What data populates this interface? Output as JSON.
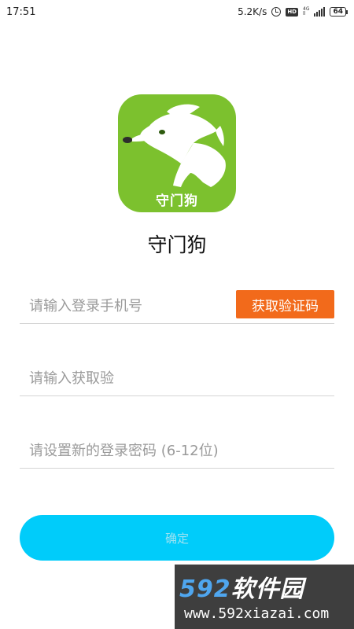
{
  "status_bar": {
    "time": "17:51",
    "speed": "5.2K/s",
    "hd": "HD",
    "network_top": "4G",
    "network_bottom": "ll",
    "battery": "64"
  },
  "logo": {
    "text": "守门狗",
    "background_color": "#7cc12e"
  },
  "app_name": "守门狗",
  "form": {
    "phone_placeholder": "请输入登录手机号",
    "code_button_label": "获取验证码",
    "code_placeholder": "请输入获取验",
    "password_placeholder": "请设置新的登录密码 (6-12位)",
    "confirm_label": "确定"
  },
  "colors": {
    "code_button": "#f26a1b",
    "confirm_button": "#00ccfa"
  },
  "watermark": {
    "number": "592",
    "title": "软件园",
    "url": "www.592xiazai.com"
  }
}
